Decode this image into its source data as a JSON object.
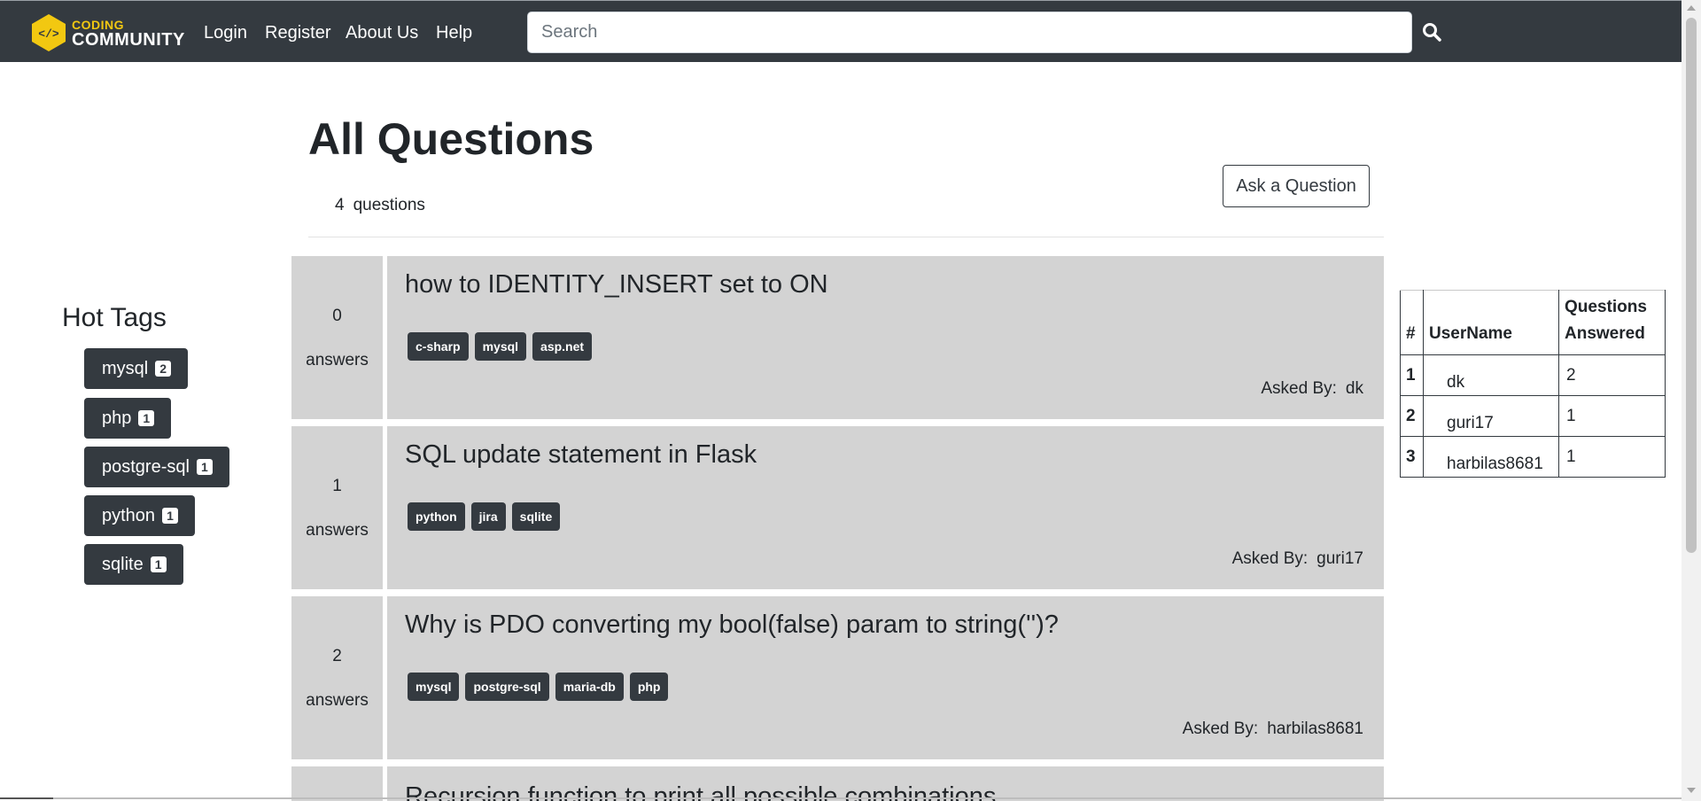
{
  "navbar": {
    "logo_line1": "CODING",
    "logo_line2": "COMMUNITY",
    "links": [
      {
        "label": "Login"
      },
      {
        "label": "Register"
      },
      {
        "label": "About Us"
      },
      {
        "label": "Help"
      }
    ],
    "search_placeholder": "Search",
    "search_icon": "search-icon",
    "logo_icon": "code-brackets-icon",
    "accent_color": "#f2c811",
    "bar_color": "#343a40"
  },
  "header": {
    "title": "All Questions",
    "count": "4",
    "count_label": "questions",
    "ask_button": "Ask a Question"
  },
  "hot_tags": {
    "title": "Hot Tags",
    "items": [
      {
        "name": "mysql",
        "count": "2"
      },
      {
        "name": "php",
        "count": "1"
      },
      {
        "name": "postgre-sql",
        "count": "1"
      },
      {
        "name": "python",
        "count": "1"
      },
      {
        "name": "sqlite",
        "count": "1"
      }
    ]
  },
  "questions": [
    {
      "answers": "0",
      "answers_label": "answers",
      "title": "how to IDENTITY_INSERT set to ON",
      "tags": [
        "c-sharp",
        "mysql",
        "asp.net"
      ],
      "asked_by_label": "Asked By:",
      "user": "dk"
    },
    {
      "answers": "1",
      "answers_label": "answers",
      "title": "SQL update statement in Flask",
      "tags": [
        "python",
        "jira",
        "sqlite"
      ],
      "asked_by_label": "Asked By:",
      "user": "guri17"
    },
    {
      "answers": "2",
      "answers_label": "answers",
      "title": "Why is PDO converting my bool(false) param to string('')?",
      "tags": [
        "mysql",
        "postgre-sql",
        "maria-db",
        "php"
      ],
      "asked_by_label": "Asked By:",
      "user": "harbilas8681"
    },
    {
      "title": "Recursion function to print all possible combinations"
    }
  ],
  "leaderboard": {
    "headers": {
      "rank": "#",
      "username": "UserName",
      "answered": "Questions Answered"
    },
    "rows": [
      {
        "rank": "1",
        "username": "dk",
        "answered": "2"
      },
      {
        "rank": "2",
        "username": "guri17",
        "answered": "1"
      },
      {
        "rank": "3",
        "username": "harbilas8681",
        "answered": "1"
      }
    ]
  }
}
